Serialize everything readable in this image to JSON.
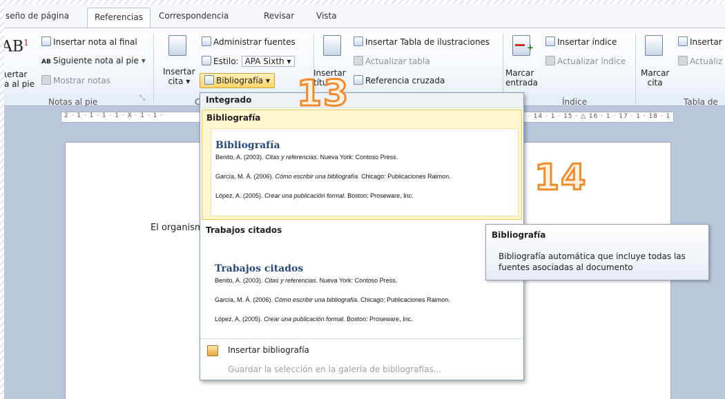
{
  "tabs": {
    "items": [
      "seño de página",
      "Referencias",
      "Correspondencia",
      "Revisar",
      "Vista"
    ],
    "active_index": 1
  },
  "ribbon": {
    "notes": {
      "insert_footnote_big": "AB",
      "insert_footnote_sup": "1",
      "insert_label_1": "ιertar",
      "insert_label_2": "a al pie",
      "insert_endnote": "Insertar nota al final",
      "next_footnote": "Siguiente nota al pie",
      "show_notes": "Mostrar notas",
      "group_label": "Notas al pie"
    },
    "citations": {
      "insert_citation_1": "Insertar",
      "insert_citation_2": "cita",
      "manage_sources": "Administrar fuentes",
      "style_label": "Estilo:",
      "style_value": "APA Sixth",
      "bibliography_button": "Bibliografía",
      "group_label": "C"
    },
    "captions": {
      "insert_table_of_figures": "Insertar Tabla de ilustraciones",
      "update_table": "Actualizar tabla",
      "cross_reference": "Referencia cruzada",
      "insert_title_1": "Insertar",
      "insert_title_2": "títu"
    },
    "index": {
      "mark_entry_1": "Marcar",
      "mark_entry_2": "entrada",
      "insert_index": "Insertar índice",
      "update_index": "Actualizar índice",
      "group_label": "Índice"
    },
    "authorities": {
      "mark_citation_1": "Marcar",
      "mark_citation_2": "cita",
      "insert": "Insertar",
      "update": "Actualiz",
      "group_label": "Tabla de"
    }
  },
  "ruler": {
    "left_marks": "2 · 1 · 1 · 1 · 1 · X · 1 · 1 ·",
    "right_marks": "· 14 · 1 · 15 · △ 16 · 1 · 17 · 1 · 18 · 1"
  },
  "document": {
    "body_text": "El organism"
  },
  "menu": {
    "section_header": "Integrado",
    "items": [
      {
        "title": "Bibliografía",
        "heading": "Bibliografía",
        "refs": [
          {
            "pre": "Benito, A. (2003).",
            "title": "Citas y referencias.",
            "post": "Nueva York: Contoso Press."
          },
          {
            "pre": "García, M. Á. (2006).",
            "title": "Cómo escribir una bibliografía.",
            "post": "Chicago: Publicaciones Raimon."
          },
          {
            "pre": "López, A. (2005).",
            "title": "Crear una publicación formal.",
            "post": "Boston: Proseware, Inc."
          }
        ]
      },
      {
        "title": "Trabajos citados",
        "heading": "Trabajos citados",
        "refs": [
          {
            "pre": "Benito, A. (2003).",
            "title": "Citas y referencias.",
            "post": "Nueva York: Contoso Press."
          },
          {
            "pre": "García, M. Á. (2006).",
            "title": "Cómo escribir una bibliografía.",
            "post": "Chicago: Publicaciones Raimon."
          },
          {
            "pre": "López, A. (2005).",
            "title": "Crear una publicación formal.",
            "post": "Boston: Proseware, Inc."
          }
        ]
      }
    ],
    "insert_bibliography": "Insertar bibliografía",
    "save_selection": "Guardar la selección en la galería de bibliografías..."
  },
  "tooltip": {
    "title": "Bibliografía",
    "description": "Bibliografía automática que incluye todas las fuentes asociadas al documento"
  },
  "callouts": {
    "first": "13",
    "second": "14"
  },
  "colors": {
    "highlight_fill": "#fff6cf",
    "highlight_border": "#f0c653",
    "heading_blue": "#27497a",
    "callout_orange": "#f08a2a"
  }
}
